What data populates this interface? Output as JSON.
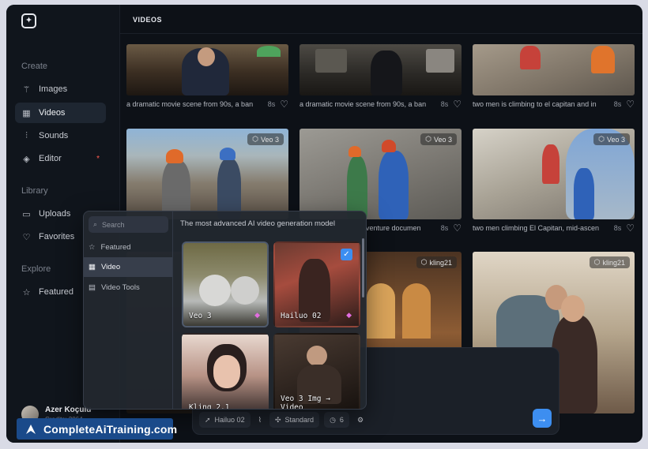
{
  "sidebar": {
    "sections": {
      "create": "Create",
      "library": "Library",
      "explore": "Explore"
    },
    "items": {
      "images": "Images",
      "videos": "Videos",
      "sounds": "Sounds",
      "editor": "Editor",
      "uploads": "Uploads",
      "favorites": "Favorites",
      "featured": "Featured"
    },
    "editor_dot": "*",
    "user": {
      "name": "Azer Koçulu",
      "credits": "Credits: 2064"
    }
  },
  "main": {
    "title": "VIDEOS",
    "cards": [
      {
        "caption": "a dramatic movie scene from 90s, a ban",
        "duration": "8s",
        "badge": ""
      },
      {
        "caption": "a dramatic movie scene from 90s, a ban",
        "duration": "8s",
        "badge": ""
      },
      {
        "caption": "two men is climbing to el capitan and in",
        "duration": "8s",
        "badge": ""
      },
      {
        "caption": "",
        "duration": "",
        "badge": "Veo 3"
      },
      {
        "caption": "venture documen",
        "duration": "8s",
        "badge": "Veo 3"
      },
      {
        "caption": "two men climbing El Capitan, mid-ascen",
        "duration": "8s",
        "badge": "Veo 3"
      },
      {
        "caption": "",
        "duration": "",
        "badge": "kling21"
      },
      {
        "caption": "",
        "duration": "",
        "badge": "kling21"
      }
    ]
  },
  "popup": {
    "search_placeholder": "Search",
    "menu": {
      "featured": "Featured",
      "video": "Video",
      "video_tools": "Video Tools"
    },
    "heading": "The most advanced AI video generation model",
    "models": [
      {
        "name": "Veo 3",
        "premium": true,
        "selected": false
      },
      {
        "name": "Hailuo 02",
        "premium": true,
        "selected": true
      },
      {
        "name": "Kling 2.1",
        "premium": false,
        "selected": false
      },
      {
        "name": "Veo 3 Img → Video",
        "premium": false,
        "selected": false
      }
    ]
  },
  "prompt_bar": {
    "model_chip": "Hailuo 02",
    "quality_chip": "Standard",
    "duration_chip": "6",
    "send_icon": "arrow-right-icon"
  },
  "watermark": {
    "text": "CompleteAiTraining.com"
  },
  "colors": {
    "background": "#0d1117",
    "accent": "#3d8ef0",
    "premium": "#e36de0",
    "watermark": "#1a4a8a"
  }
}
